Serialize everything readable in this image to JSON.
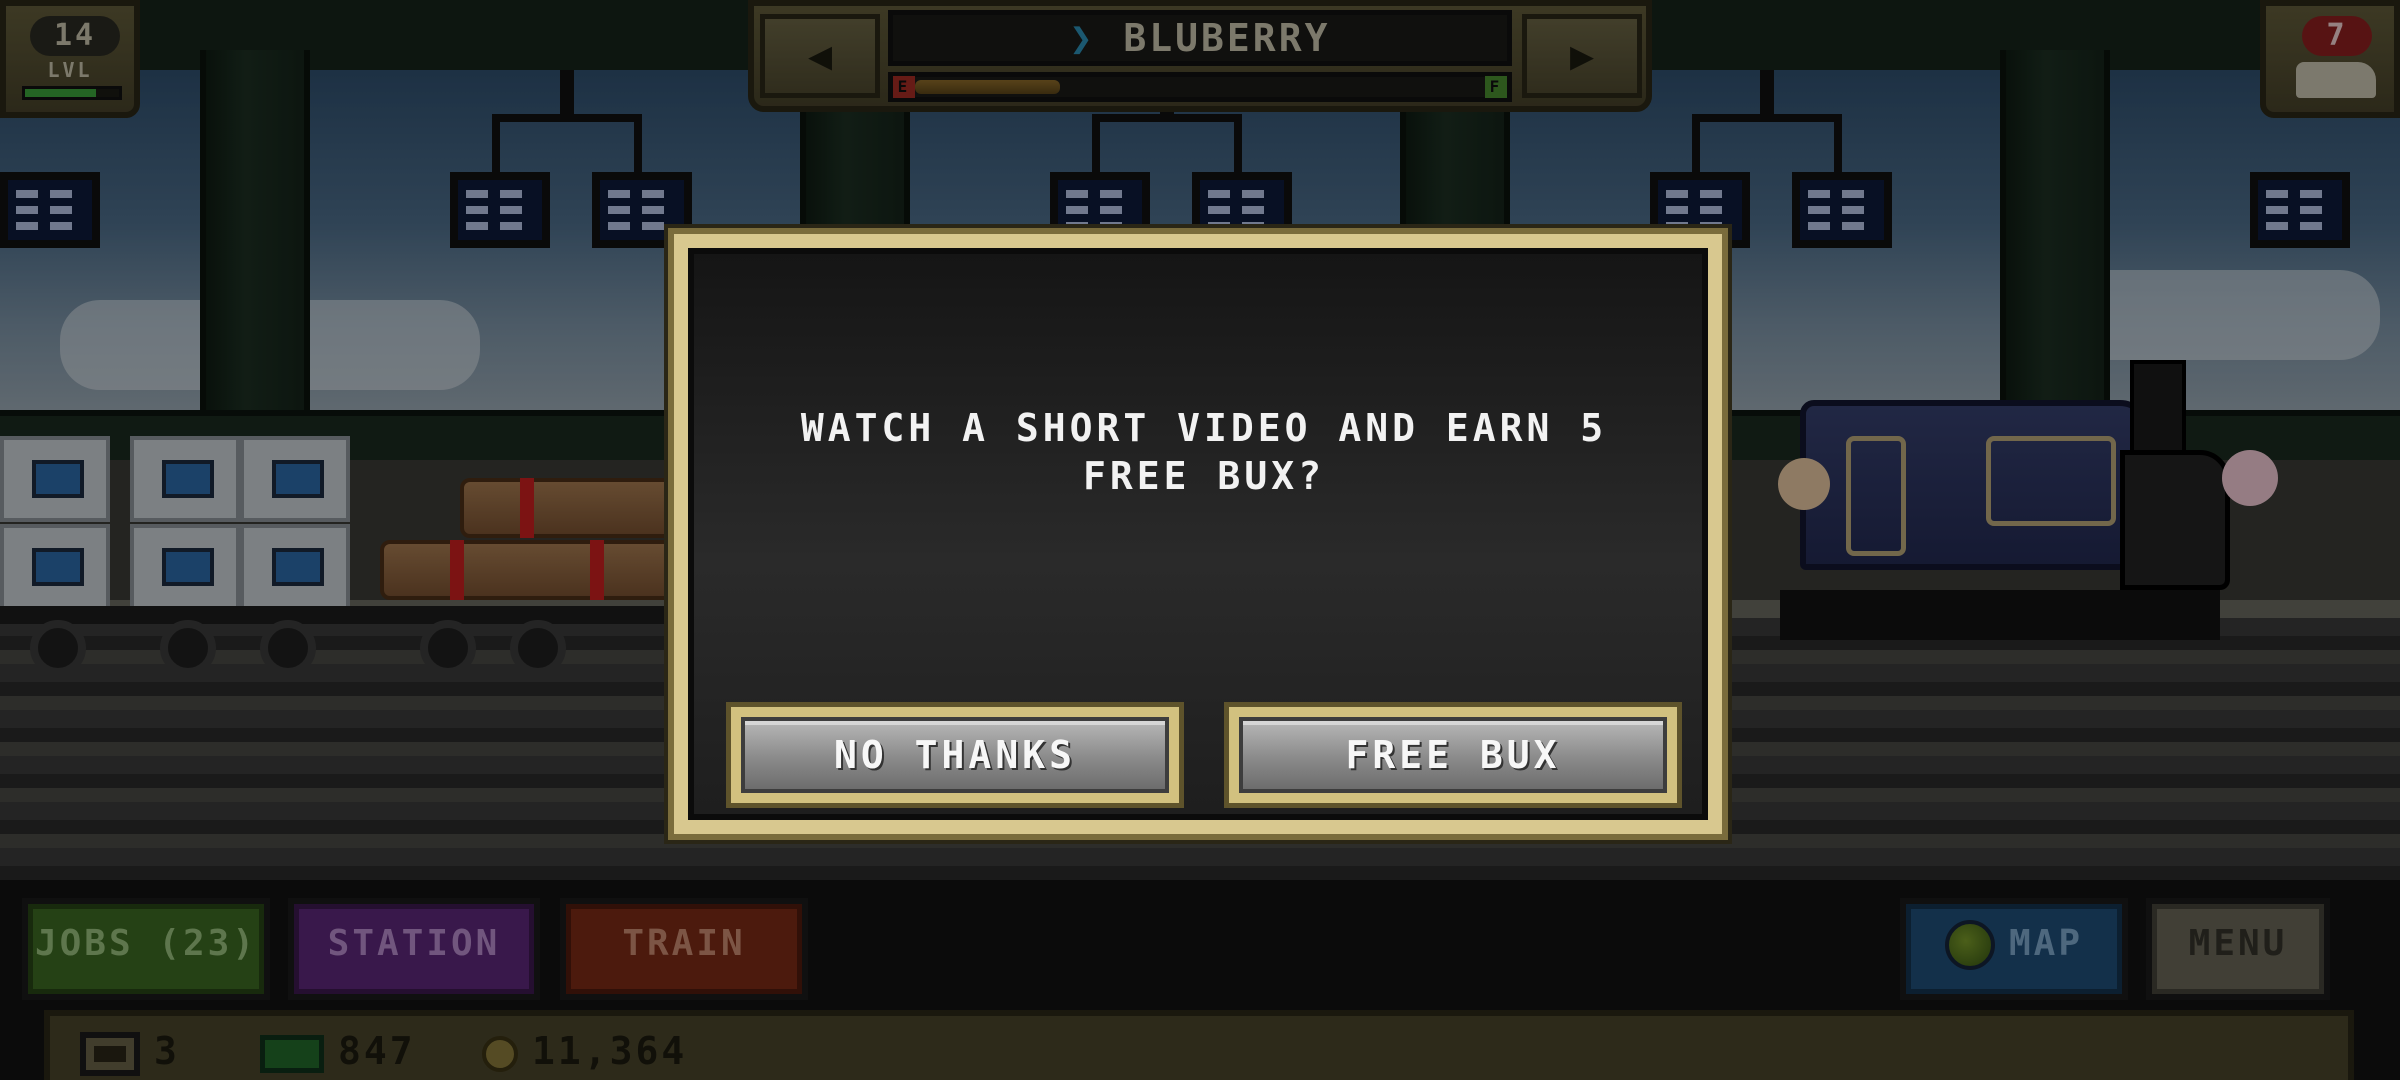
{
  "hud": {
    "level": {
      "value": "14",
      "label": "LVL",
      "progress": 0.75
    },
    "train_selector": {
      "name": "BLUBERRY",
      "fuel_empty_label": "E",
      "fuel_full_label": "F",
      "fuel_level": 0.25,
      "prev_icon": "left-triangle-icon",
      "next_icon": "right-triangle-icon"
    },
    "alerts": {
      "count": "7",
      "icon": "train-icon"
    }
  },
  "dialog": {
    "message": "WATCH A SHORT VIDEO AND EARN 5 FREE BUX?",
    "no_thanks_label": "NO THANKS",
    "free_bux_label": "FREE BUX"
  },
  "bottom_nav": {
    "jobs_label": "JOBS (23)",
    "station_label": "STATION",
    "train_label": "TRAIN",
    "map_label": "MAP",
    "menu_label": "MENU"
  },
  "stats": {
    "cars": "3",
    "bux": "847",
    "coins": "11,364"
  },
  "colors": {
    "dialog_border": "#d8c88f",
    "jobs": "#3c6a22",
    "station": "#5c2779",
    "train": "#7b2a16",
    "map": "#1f4e78",
    "menu": "#6a6758"
  }
}
